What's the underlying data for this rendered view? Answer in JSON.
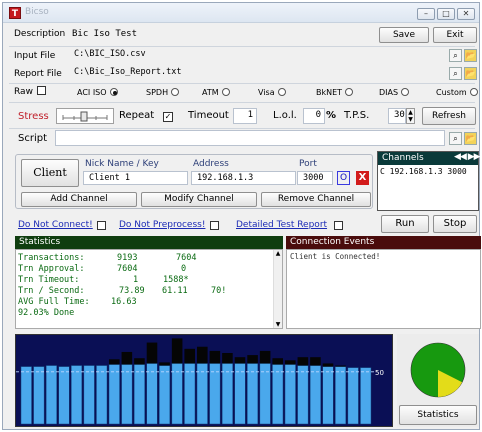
{
  "window": {
    "title": "Bicso",
    "minimize": "–",
    "maximize": "□",
    "close": "✕"
  },
  "header": {
    "description_label": "Description",
    "description_value": "Bic Iso Test",
    "save_label": "Save",
    "exit_label": "Exit"
  },
  "files": {
    "input_label": "Input File",
    "input_value": "C:\\BIC_ISO.csv",
    "report_label": "Report File",
    "report_value": "C:\\Bic_Iso_Report.txt"
  },
  "raw": {
    "label": "Raw",
    "checked": false,
    "options": [
      {
        "label": "ACI ISO",
        "selected": true
      },
      {
        "label": "SPDH",
        "selected": false
      },
      {
        "label": "ATM",
        "selected": false
      },
      {
        "label": "Visa",
        "selected": false
      },
      {
        "label": "BkNET",
        "selected": false
      },
      {
        "label": "DIAS",
        "selected": false
      },
      {
        "label": "Custom",
        "selected": false
      }
    ]
  },
  "stress": {
    "label": "Stress",
    "repeat_label": "Repeat",
    "repeat_checked": true,
    "timeout_label": "Timeout",
    "timeout_value": "1",
    "lol_label": "L.o.l.",
    "lol_value": "0",
    "lol_unit": "%",
    "tps_label": "T.P.S.",
    "tps_value": "30",
    "refresh_label": "Refresh"
  },
  "script": {
    "label": "Script",
    "value": ""
  },
  "client": {
    "button_label": "Client",
    "nick_header": "Nick Name / Key",
    "nick_value": "Client 1",
    "address_header": "Address",
    "address_value": "192.168.1.3",
    "port_header": "Port",
    "port_value": "3000",
    "o_label": "O",
    "x_label": "X",
    "add_label": "Add Channel",
    "modify_label": "Modify Channel",
    "remove_label": "Remove Channel"
  },
  "channels": {
    "title": "Channels",
    "items": [
      "C 192.168.1.3 3000"
    ]
  },
  "options": {
    "no_connect": "Do Not Connect!",
    "no_preprocess": "Do Not Preprocess!",
    "detailed_report": "Detailed Test Report",
    "run_label": "Run",
    "stop_label": "Stop"
  },
  "statistics": {
    "title": "Statistics",
    "rows": [
      {
        "label": "Transactions:",
        "a": "9193",
        "b": "7604",
        "c": ""
      },
      {
        "label": "Trn Approval:",
        "a": "7604",
        "b": "0",
        "c": ""
      },
      {
        "label": "Trn Timeout:",
        "a": "1",
        "b": "1588*",
        "c": ""
      },
      {
        "label": "Trn / Second:",
        "a": "73.89",
        "b": "61.11",
        "c": "70!"
      },
      {
        "label": "AVG Full Time:",
        "a": "16.63",
        "b": "",
        "c": ""
      },
      {
        "label": "92.03% Done",
        "a": "",
        "b": "",
        "c": ""
      }
    ]
  },
  "events": {
    "title": "Connection Events",
    "lines": [
      "Client is Connected!"
    ]
  },
  "chart_data": {
    "type": "bar",
    "series": [
      {
        "values": [
          55,
          55,
          56,
          55,
          56,
          56,
          56,
          57,
          57,
          57,
          58,
          56,
          58,
          58,
          58,
          58,
          58,
          58,
          58,
          58,
          57,
          57,
          56,
          56,
          55,
          55,
          54,
          54
        ]
      },
      {
        "values": [
          0,
          0,
          0,
          0,
          0,
          0,
          0,
          5,
          12,
          6,
          20,
          3,
          24,
          14,
          16,
          12,
          10,
          6,
          8,
          12,
          6,
          4,
          8,
          8,
          3,
          1,
          0,
          0
        ]
      }
    ],
    "colors": [
      "#4aa8ec",
      "#050505"
    ],
    "reference_line": 50,
    "reference_label": "50",
    "ylim": [
      0,
      100
    ]
  },
  "pie": {
    "approved_pct": 92.03,
    "colors": [
      "#17990f",
      "#e3dc19"
    ]
  },
  "stats_button_label": "Statistics"
}
